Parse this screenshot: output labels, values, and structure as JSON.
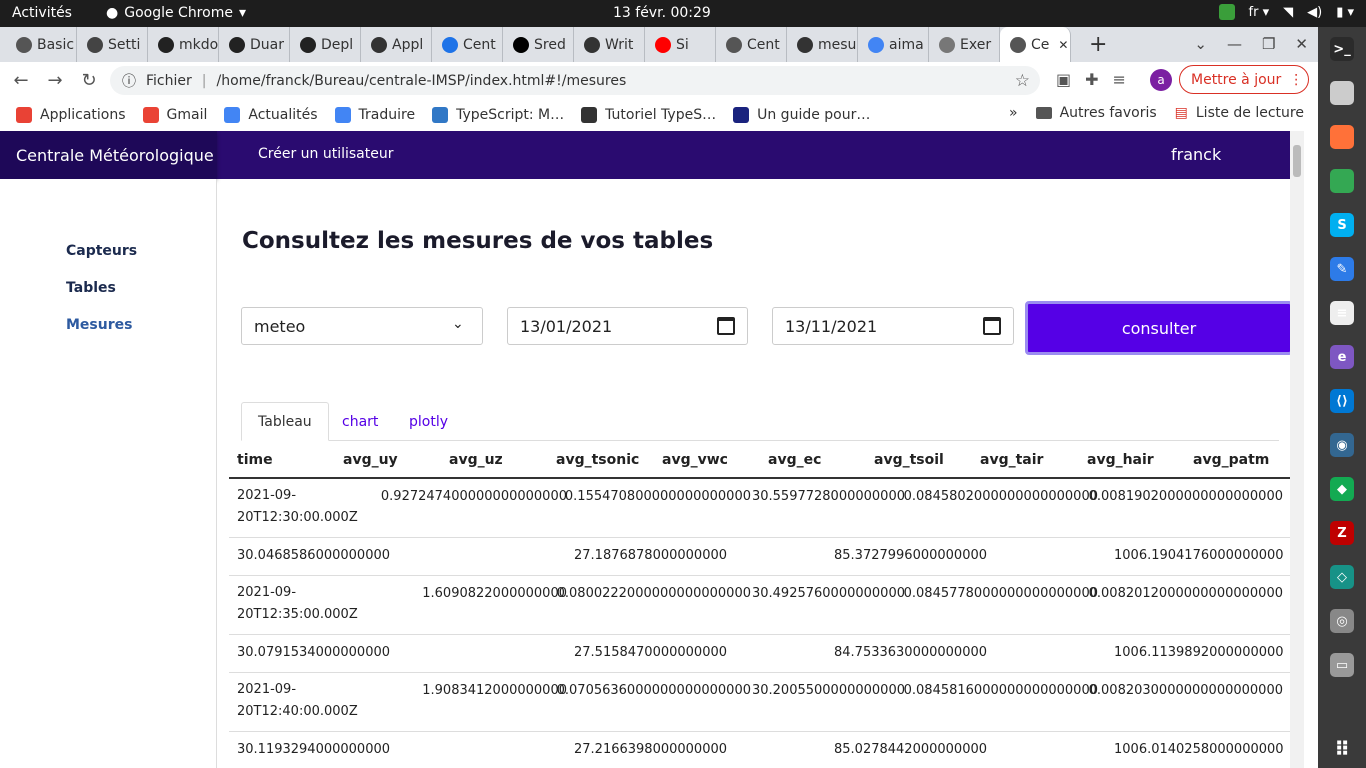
{
  "os": {
    "activities": "Activités",
    "app": "Google Chrome",
    "clock": "13 févr.  00:29",
    "lang": "fr"
  },
  "tabs": [
    {
      "label": "Basic",
      "color": "#555"
    },
    {
      "label": "Setti",
      "color": "#444"
    },
    {
      "label": "mkdo",
      "color": "#222"
    },
    {
      "label": "Duar",
      "color": "#222"
    },
    {
      "label": "Depl",
      "color": "#222"
    },
    {
      "label": "Appl",
      "color": "#333"
    },
    {
      "label": "Cent",
      "color": "#1e73e8"
    },
    {
      "label": "Sred",
      "color": "#000"
    },
    {
      "label": "Writ",
      "color": "#333"
    },
    {
      "label": "Si",
      "color": "#f00"
    },
    {
      "label": "Cent",
      "color": "#555"
    },
    {
      "label": "mesu",
      "color": "#333"
    },
    {
      "label": "aima",
      "color": "#4285f4"
    },
    {
      "label": "Exer",
      "color": "#777"
    },
    {
      "label": "Ce",
      "color": "#555",
      "active": true
    }
  ],
  "address": {
    "scheme": "Fichier",
    "url": "/home/franck/Bureau/centrale-IMSP/index.html#!/mesures",
    "avatar": "a",
    "update": "Mettre à jour"
  },
  "bookmarks": [
    {
      "label": "Applications",
      "color": "#e94235"
    },
    {
      "label": "Gmail",
      "color": "#ea4335"
    },
    {
      "label": "Actualités",
      "color": "#4285f4"
    },
    {
      "label": "Traduire",
      "color": "#4285f4"
    },
    {
      "label": "TypeScript: M…",
      "color": "#3178c6"
    },
    {
      "label": "Tutoriel TypeS…",
      "color": "#333"
    },
    {
      "label": "Un guide pour…",
      "color": "#1a237e"
    }
  ],
  "bookmarks_right": {
    "more": "»",
    "other": "Autres favoris",
    "reading": "Liste de lecture"
  },
  "navbar": {
    "brand": "Centrale Météorologique",
    "create": "Créer un utilisateur",
    "user": "franck"
  },
  "sidebar": {
    "items": [
      "Capteurs",
      "Tables",
      "Mesures"
    ]
  },
  "page": {
    "title": "Consultez les mesures de vos tables",
    "table_select": "meteo",
    "date_from": "13/01/2021",
    "date_to": "13/11/2021",
    "button": "consulter"
  },
  "view_tabs": [
    "Tableau",
    "chart",
    "plotly"
  ],
  "table": {
    "headers": [
      "time",
      "avg_uy",
      "avg_uz",
      "avg_tsonic",
      "avg_vwc",
      "avg_ec",
      "avg_tsoil",
      "avg_tair",
      "avg_hair",
      "avg_patm"
    ],
    "records": [
      {
        "time1": "2021-09-",
        "time2": "20T12:30:00.000Z",
        "v": [
          "0.927247400000000000000",
          "0.155470800000000000000",
          "30.5597728000000000",
          "0.0845802000000000000000",
          "0.0081902000000000000000"
        ],
        "w": [
          "30.0468586000000000",
          "27.1876878000000000",
          "85.3727996000000000",
          "1006.1904176000000000"
        ]
      },
      {
        "time1": "2021-09-",
        "time2": "20T12:35:00.000Z",
        "v": [
          "1.6090822000000000",
          "0.0800222000000000000000",
          "30.4925760000000000",
          "0.0845778000000000000000",
          "0.0082012000000000000000"
        ],
        "w": [
          "30.0791534000000000",
          "27.5158470000000000",
          "84.7533630000000000",
          "1006.1139892000000000"
        ]
      },
      {
        "time1": "2021-09-",
        "time2": "20T12:40:00.000Z",
        "v": [
          "1.9083412000000000",
          "0.0705636000000000000000",
          "30.2005500000000000",
          "0.0845816000000000000000",
          "0.0082030000000000000000"
        ],
        "w": [
          "30.1193294000000000",
          "27.2166398000000000",
          "85.0278442000000000",
          "1006.0140258000000000"
        ]
      }
    ]
  },
  "dock": [
    {
      "icon": "terminal-icon",
      "color": "#2b2b2b",
      "glyph": ">_"
    },
    {
      "icon": "files-icon",
      "color": "#ccc",
      "glyph": ""
    },
    {
      "icon": "firefox-icon",
      "color": "#ff7139",
      "glyph": ""
    },
    {
      "icon": "chrome-icon",
      "color": "#34a853",
      "glyph": ""
    },
    {
      "icon": "skype-icon",
      "color": "#00aff0",
      "glyph": "S"
    },
    {
      "icon": "text-editor-icon",
      "color": "#2d7be8",
      "glyph": "✎"
    },
    {
      "icon": "libreoffice-writer-icon",
      "color": "#eee",
      "glyph": "≡"
    },
    {
      "icon": "emacs-icon",
      "color": "#7e57c2",
      "glyph": "e"
    },
    {
      "icon": "vscode-icon",
      "color": "#0078d4",
      "glyph": "⟨⟩"
    },
    {
      "icon": "postgres-icon",
      "color": "#336791",
      "glyph": "◉"
    },
    {
      "icon": "mongodb-compass-icon",
      "color": "#13aa52",
      "glyph": "◆"
    },
    {
      "icon": "filezilla-icon",
      "color": "#bf0000",
      "glyph": "Z"
    },
    {
      "icon": "gitkraken-icon",
      "color": "#179287",
      "glyph": "◇"
    },
    {
      "icon": "disk-icon",
      "color": "#888",
      "glyph": "◎"
    },
    {
      "icon": "drive-icon",
      "color": "#999",
      "glyph": "▭"
    },
    {
      "icon": "app-grid-icon",
      "color": "#3a3a3a",
      "glyph": "⠿"
    }
  ]
}
